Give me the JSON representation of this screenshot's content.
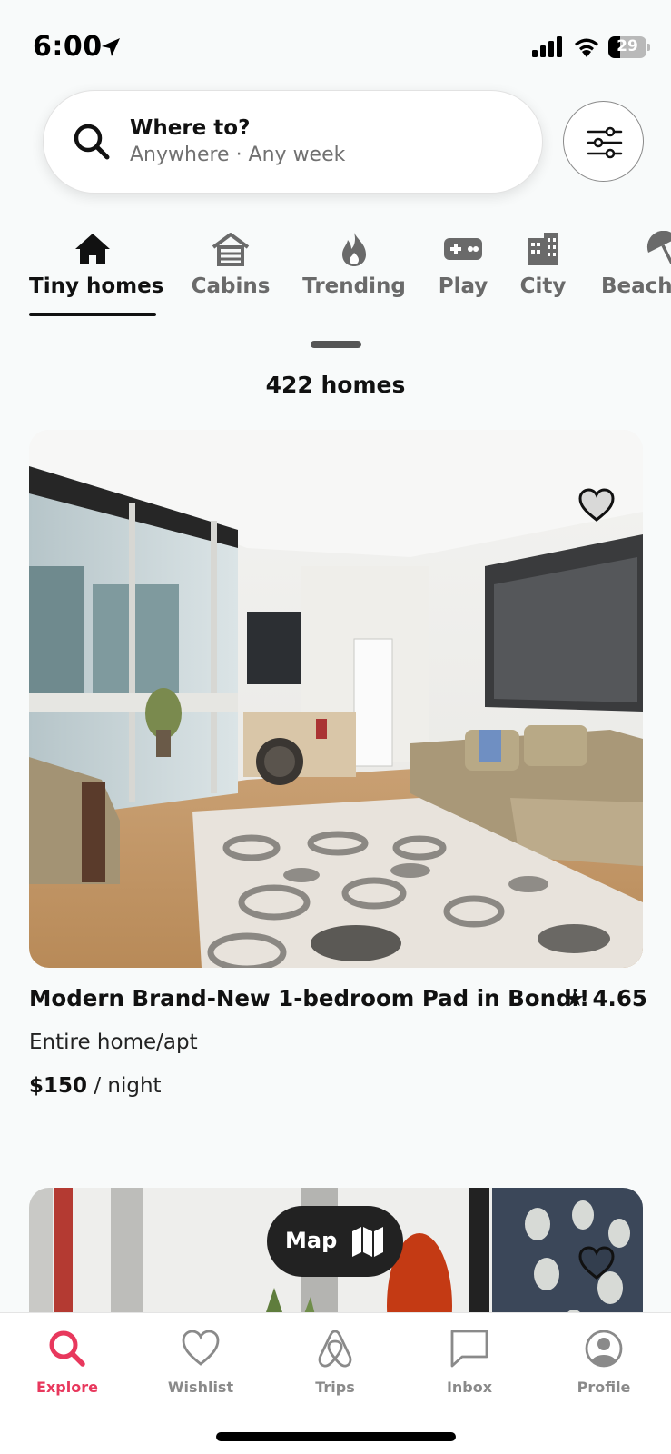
{
  "status_bar": {
    "time": "6:00",
    "battery": "29",
    "icons": [
      "location-arrow-icon",
      "cellular-signal-icon",
      "wifi-icon",
      "battery-icon"
    ]
  },
  "search": {
    "title": "Where to?",
    "subtitle": "Anywhere · Any week",
    "icon": "search-icon",
    "filter_icon": "sliders-icon"
  },
  "categories": [
    {
      "label": "Tiny homes",
      "icon": "house-icon",
      "active": true
    },
    {
      "label": "Cabins",
      "icon": "cabin-icon",
      "active": false
    },
    {
      "label": "Trending",
      "icon": "fire-icon",
      "active": false
    },
    {
      "label": "Play",
      "icon": "gamepad-icon",
      "active": false
    },
    {
      "label": "City",
      "icon": "buildings-icon",
      "active": false
    },
    {
      "label": "Beach",
      "icon": "umbrella-icon",
      "active": false
    }
  ],
  "results": {
    "count_label": "422 homes"
  },
  "listings": [
    {
      "title": "Modern Brand-New 1-bedroom Pad in Bondi!",
      "rating": "4.65",
      "type": "Entire home/apt",
      "price": "$150",
      "price_unit": " / night",
      "favorited": false
    }
  ],
  "map_button": {
    "label": "Map",
    "icon": "map-icon"
  },
  "tab_bar": {
    "tabs": [
      {
        "label": "Explore",
        "icon": "search-icon",
        "active": true
      },
      {
        "label": "Wishlist",
        "icon": "heart-icon",
        "active": false
      },
      {
        "label": "Trips",
        "icon": "airbnb-logo-icon",
        "active": false
      },
      {
        "label": "Inbox",
        "icon": "message-icon",
        "active": false
      },
      {
        "label": "Profile",
        "icon": "user-circle-icon",
        "active": false
      }
    ]
  },
  "colors": {
    "accent": "#e8385d",
    "text_primary": "#111111",
    "text_secondary": "#717171",
    "map_button_bg": "#222222"
  }
}
